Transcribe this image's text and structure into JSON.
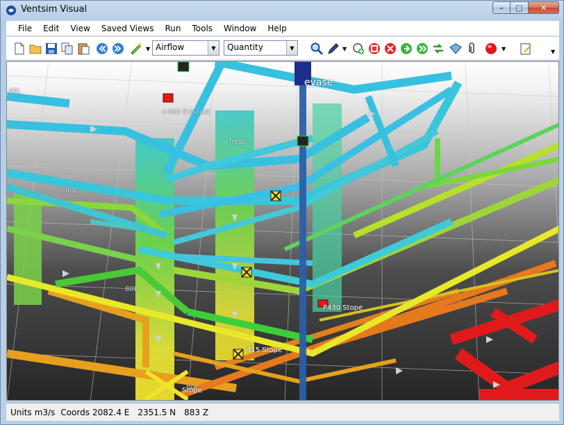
{
  "window": {
    "title": "Ventsim Visual"
  },
  "menu": [
    "File",
    "Edit",
    "View",
    "Saved Views",
    "Run",
    "Tools",
    "Window",
    "Help"
  ],
  "toolbar": {
    "left_icons": [
      "new-file-icon",
      "open-folder-icon",
      "save-icon",
      "copy-icon",
      "paste-icon",
      "back-icon",
      "forward-icon",
      "wand-icon"
    ],
    "data_type": "Airflow",
    "data_value": "Quantity",
    "right_icons": [
      "zoom-icon",
      "pen-icon",
      "fan-add-icon",
      "stop-red-icon",
      "delete-icon",
      "play-green-icon",
      "fast-forward-icon",
      "simulate-icon",
      "view-3d-icon",
      "attach-icon",
      "color-circle-icon",
      "note-icon"
    ]
  },
  "viewport": {
    "labels": {
      "evase": "evase",
      "exhaust": "+400 Exhaust",
      "fresh": "fresh",
      "p430": "P430 Stope",
      "stope415": "415 Stope",
      "stope_bottom": "Stope",
      "lvl_a": "40L",
      "lvl_b": "80L",
      "lvl_c": "80L",
      "lvl_d": "00L"
    }
  },
  "status": {
    "units_label": "Units",
    "units_value": "m3/s",
    "coords_label": "Coords",
    "easting": "2082.4 E",
    "northing": "2351.5 N",
    "elevation": "883 Z"
  },
  "colors": {
    "cyan": "#38c0e0",
    "green": "#3ccf3c",
    "yellow": "#e8e82a",
    "orange": "#e6781e",
    "red": "#e01a1a",
    "navy": "#1c2f8c"
  }
}
